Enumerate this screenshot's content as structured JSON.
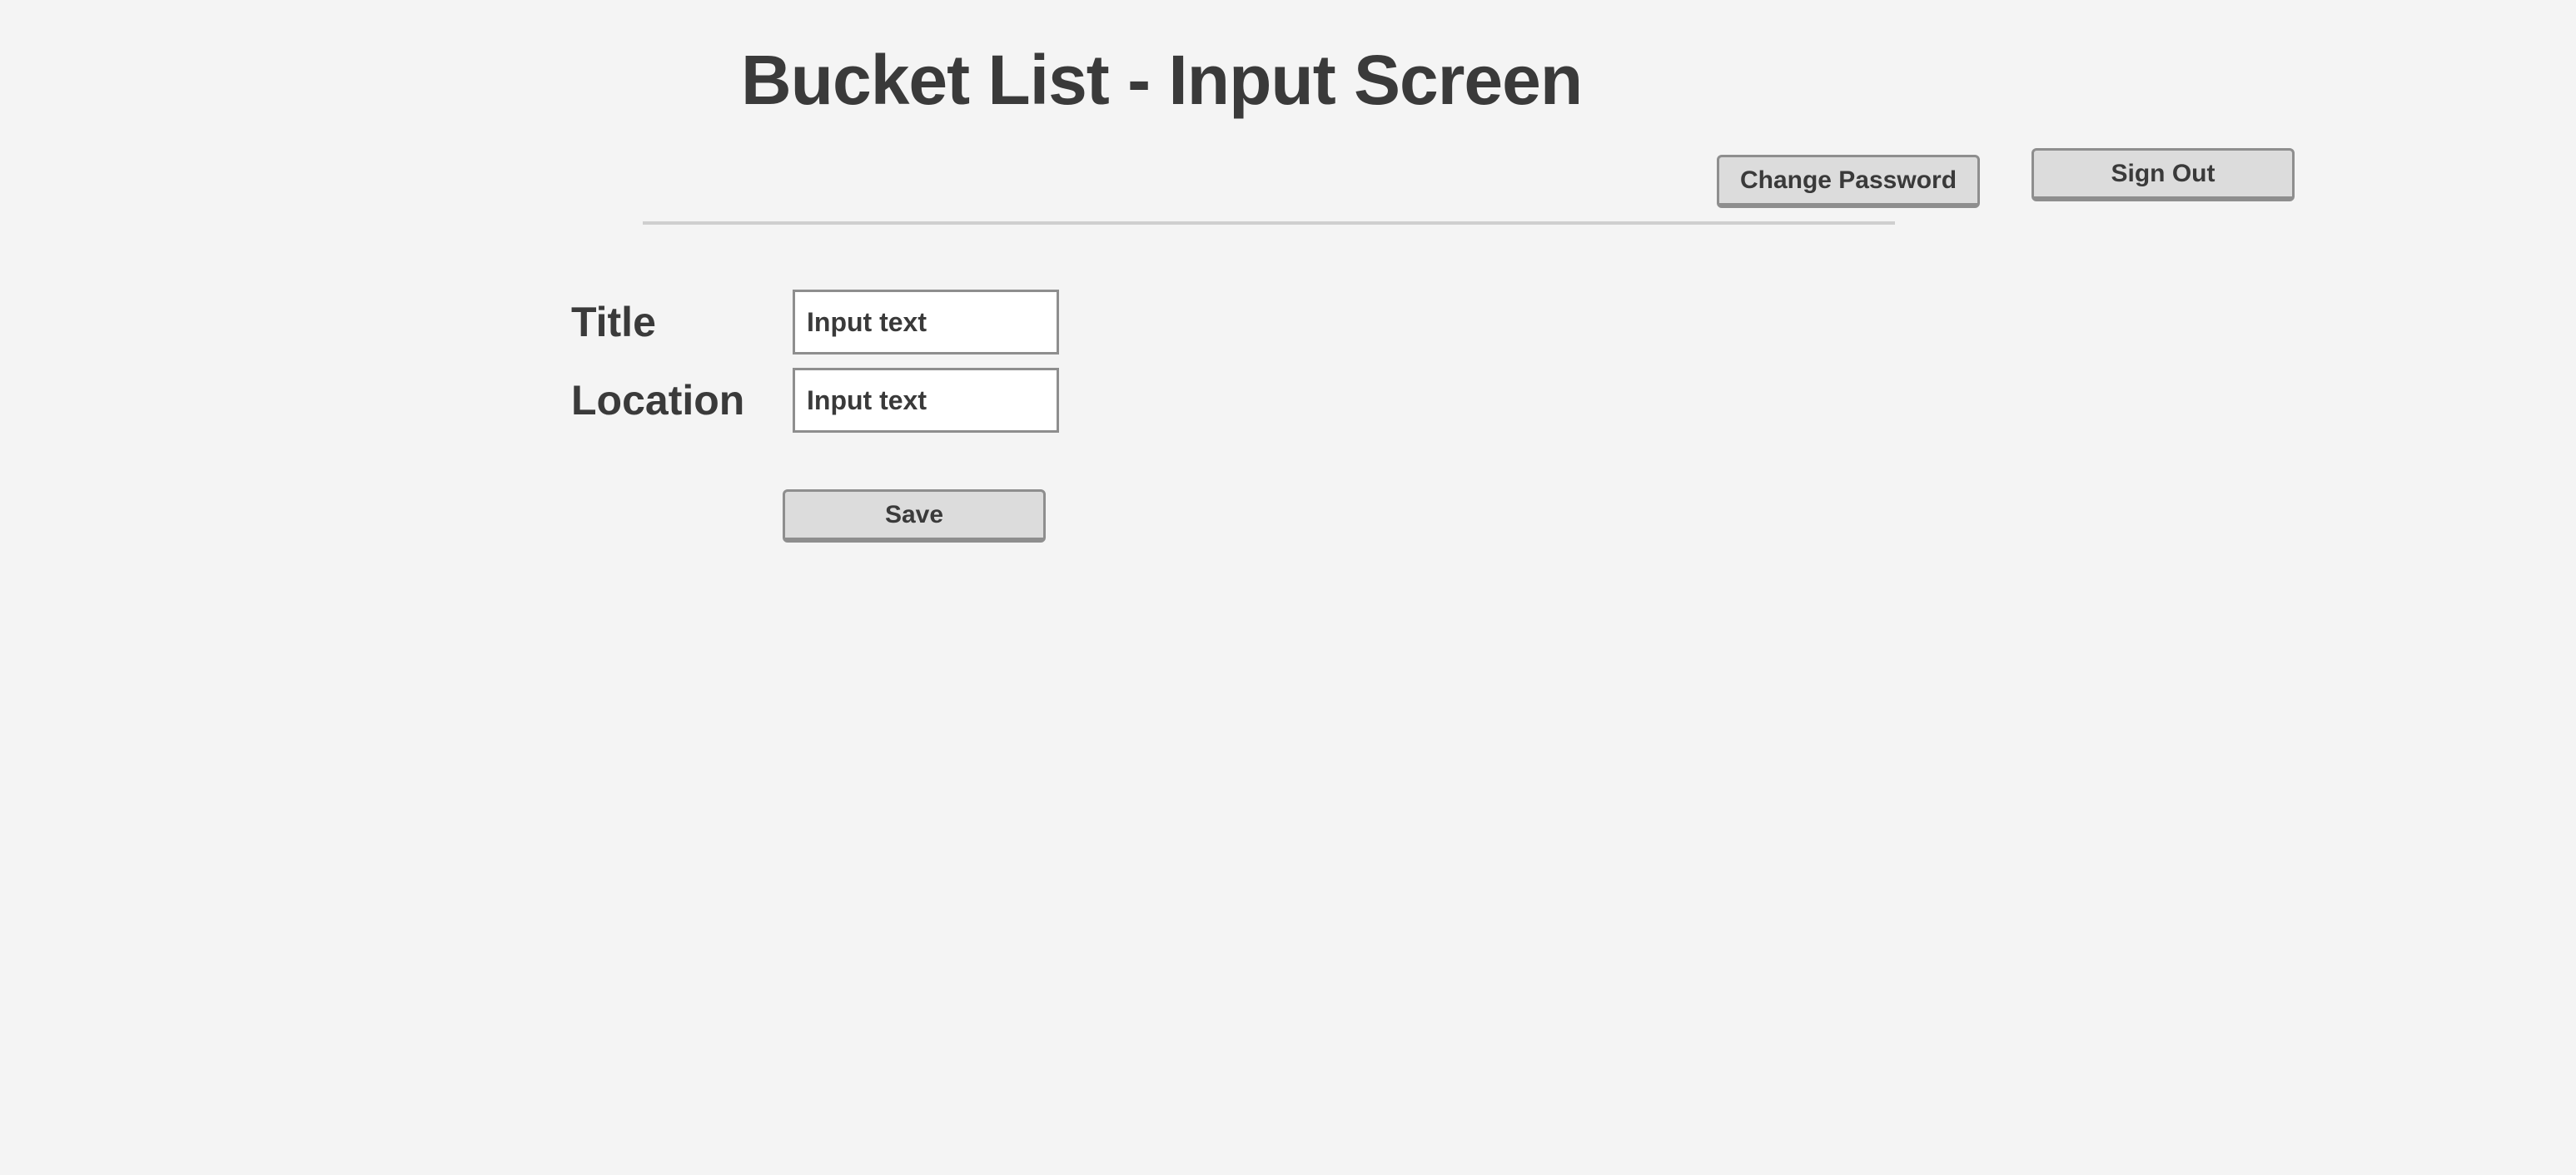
{
  "header": {
    "title": "Bucket List - Input Screen",
    "change_password_label": "Change Password",
    "sign_out_label": "Sign Out"
  },
  "form": {
    "title_label": "Title",
    "title_placeholder": "Input text",
    "location_label": "Location",
    "location_placeholder": "Input text",
    "save_label": "Save"
  },
  "colors": {
    "background": "#f4f4f4",
    "text": "#3a3a3a",
    "button_fill": "#dcdcdc",
    "border": "#8e8e8e",
    "divider": "#cfcfcf"
  }
}
